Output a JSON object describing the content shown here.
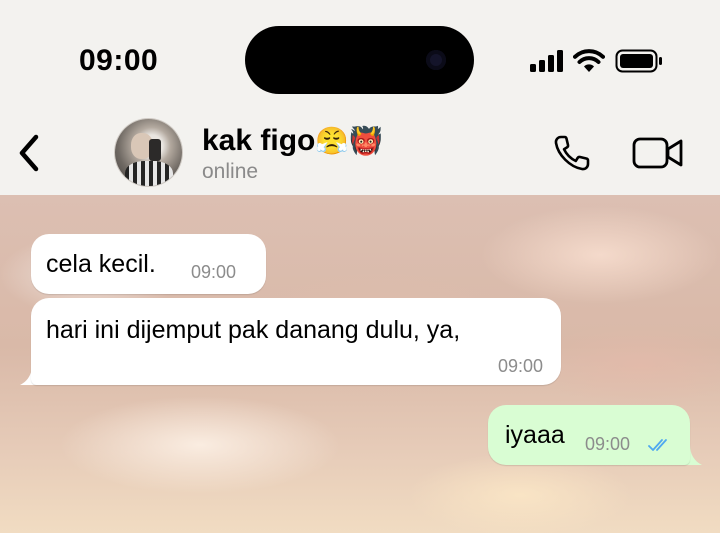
{
  "status_bar": {
    "time": "09:00",
    "icons": [
      "signal-icon",
      "wifi-icon",
      "battery-icon"
    ]
  },
  "header": {
    "contact_name": "kak figo",
    "name_emojis": "😤👹",
    "status": "online",
    "actions": [
      "back-icon",
      "phone-call-icon",
      "video-call-icon"
    ]
  },
  "messages": [
    {
      "direction": "incoming",
      "text": "cela kecil.",
      "time": "09:00"
    },
    {
      "direction": "incoming",
      "text": "hari ini dijemput pak danang dulu, ya,",
      "time": "09:00"
    },
    {
      "direction": "outgoing",
      "text": "iyaaa",
      "time": "09:00",
      "read_receipt": "double-check-read"
    }
  ],
  "colors": {
    "incoming_bubble": "#ffffff",
    "outgoing_bubble": "#d9fdd3",
    "read_ticks": "#4fa8f0",
    "timestamp": "#8c8c8c",
    "header_bg": "#f3f2ef"
  }
}
